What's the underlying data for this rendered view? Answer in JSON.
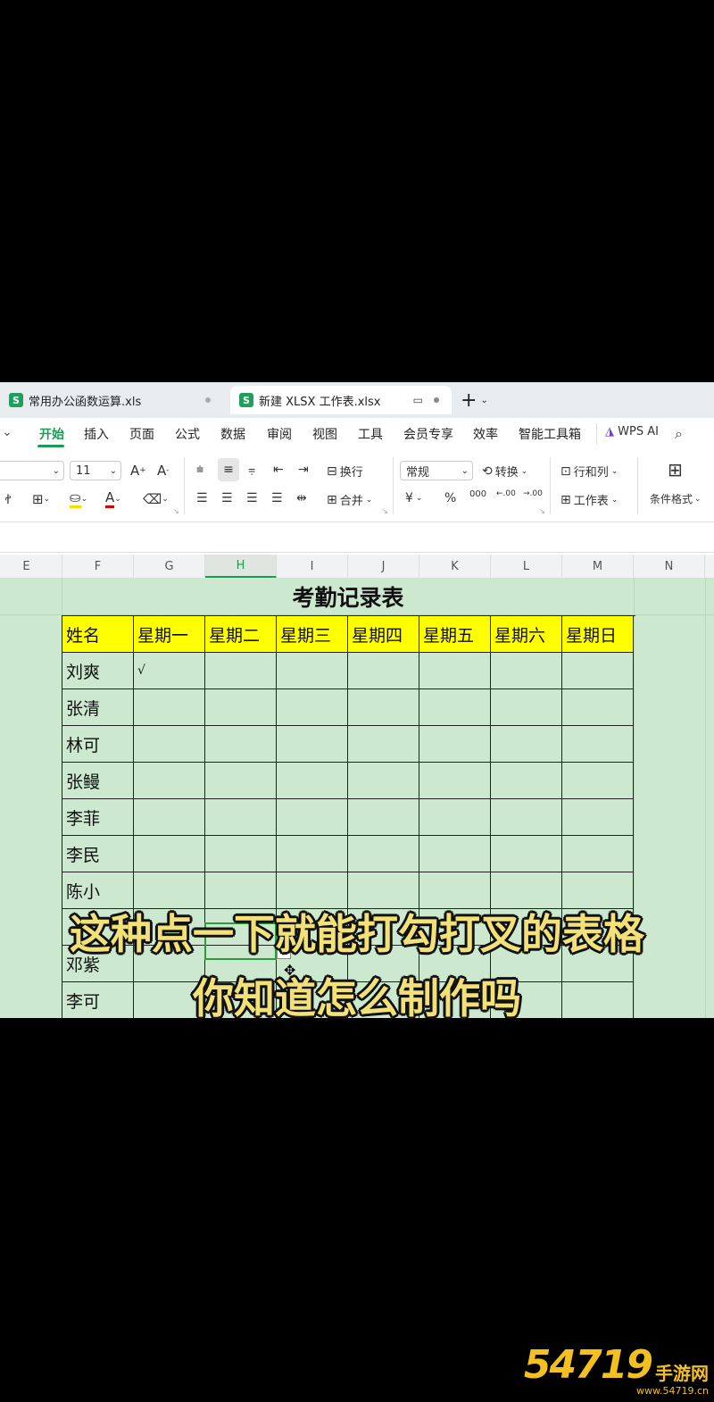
{
  "tabs": [
    {
      "label": "常用办公函数运算.xls",
      "active": false
    },
    {
      "label": "新建 XLSX 工作表.xlsx",
      "active": true
    }
  ],
  "new_tab": "+",
  "menu": [
    "开始",
    "插入",
    "页面",
    "公式",
    "数据",
    "审阅",
    "视图",
    "工具",
    "会员专享",
    "效率",
    "智能工具箱"
  ],
  "wps_ai": "WPS AI",
  "ribbon": {
    "font_size": "11",
    "wrap": "换行",
    "merge": "合并",
    "number_format": "常规",
    "convert": "转换",
    "rows_cols": "行和列",
    "worksheet": "工作表",
    "cond_format": "条件格式",
    "percent": "%",
    "currency": "¥",
    "thousands": "000",
    "inc_dec": ".00",
    "dec_dec": ".00",
    "font_grow": "A",
    "font_shrink": "A",
    "font_color": "A"
  },
  "columns": [
    "E",
    "F",
    "G",
    "H",
    "I",
    "J",
    "K",
    "L",
    "M",
    "N"
  ],
  "sheet": {
    "title": "考勤记录表",
    "headers": [
      "姓名",
      "星期一",
      "星期二",
      "星期三",
      "星期四",
      "星期五",
      "星期六",
      "星期日"
    ],
    "names": [
      "刘爽",
      "张清",
      "林可",
      "张鳗",
      "李菲",
      "李民",
      "陈小",
      "",
      "邓紫",
      "李可"
    ],
    "check_mark": "√"
  },
  "subtitles": [
    "这种点一下就能打勾打叉的表格",
    "你知道怎么制作吗"
  ],
  "watermark": {
    "main": "54719",
    "site": "手游网",
    "url": "www.54719.cn"
  },
  "colors": {
    "accent": "#1d9b55",
    "header_fill": "#ffff00",
    "grid_fill": "#cce8cf",
    "subtitle": "#f2e079"
  }
}
